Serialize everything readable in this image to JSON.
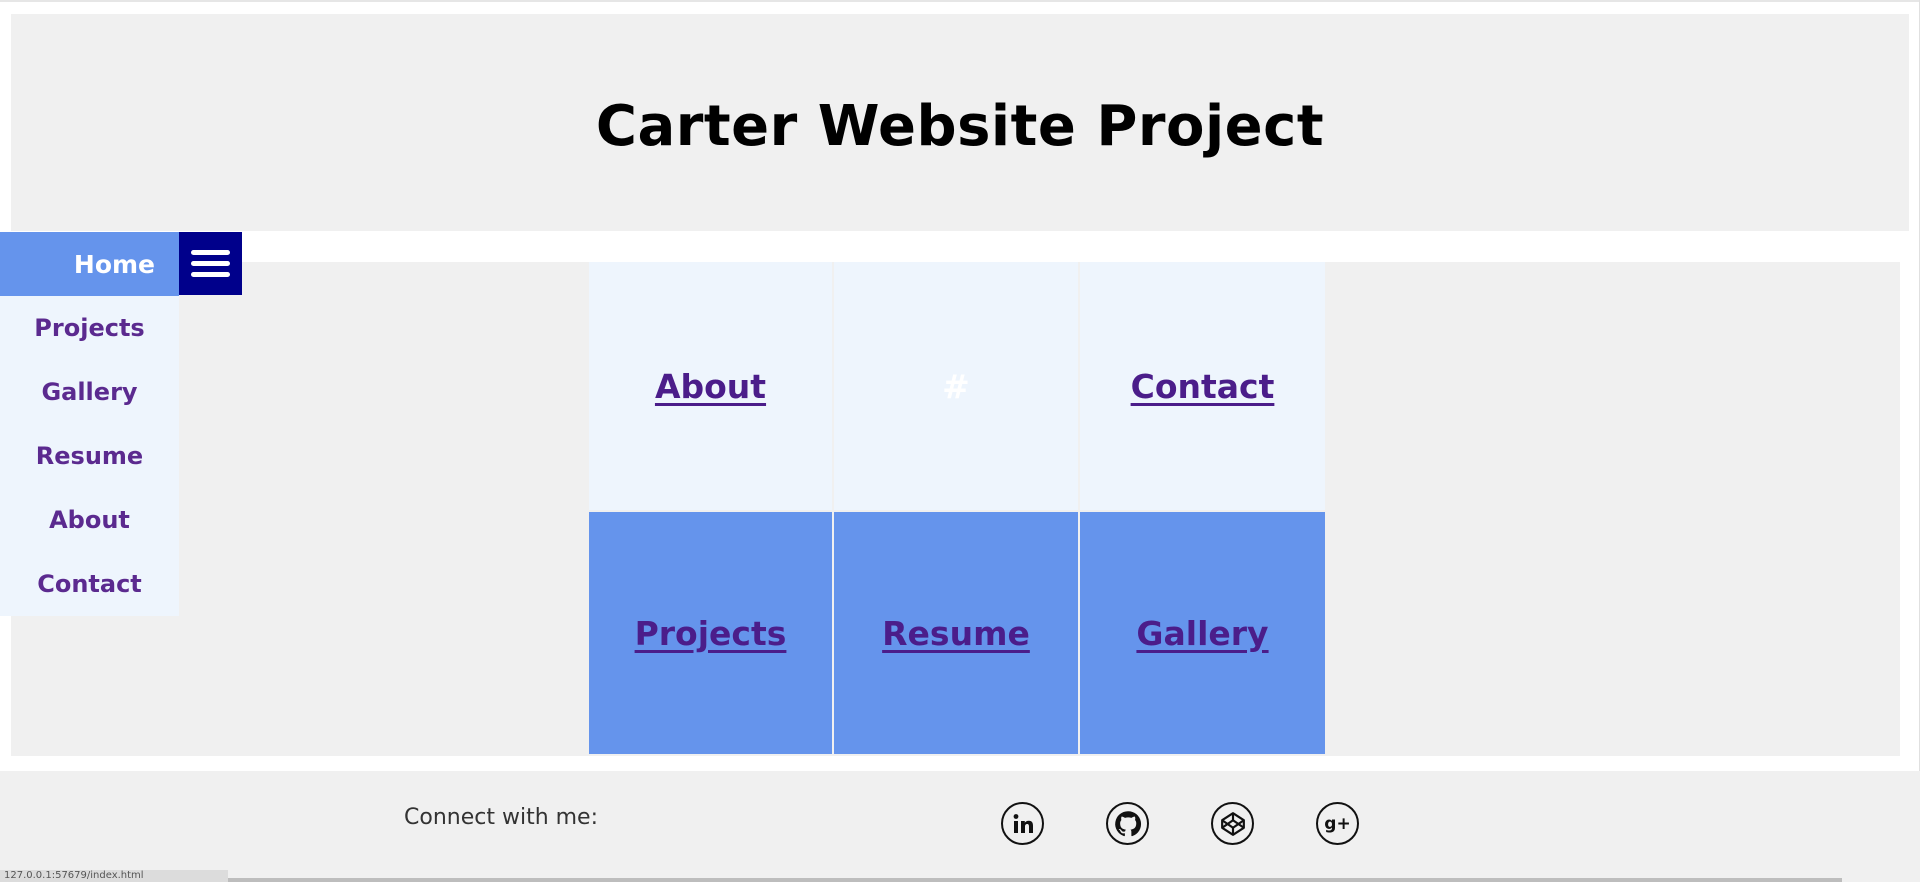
{
  "header": {
    "title": "Carter Website Project"
  },
  "nav": {
    "items": [
      "Home",
      "Projects",
      "Gallery",
      "Resume",
      "About",
      "Contact"
    ],
    "menu_icon": "hamburger-icon"
  },
  "grid": {
    "tiles": [
      "About",
      "#",
      "Contact",
      "Projects",
      "Resume",
      "Gallery"
    ]
  },
  "footer": {
    "connect_label": "Connect with me:",
    "social_icons": [
      "linkedin-icon",
      "github-icon",
      "codepen-icon",
      "google-plus-icon"
    ]
  },
  "colors": {
    "accent_blue": "#6594ec",
    "navy": "#00008b",
    "link_purple": "#4b1d8a",
    "panel_gray": "#f0f0f0",
    "tile_light": "#eef5fd"
  },
  "status": {
    "url_hint": "127.0.0.1:57679/index.html"
  }
}
